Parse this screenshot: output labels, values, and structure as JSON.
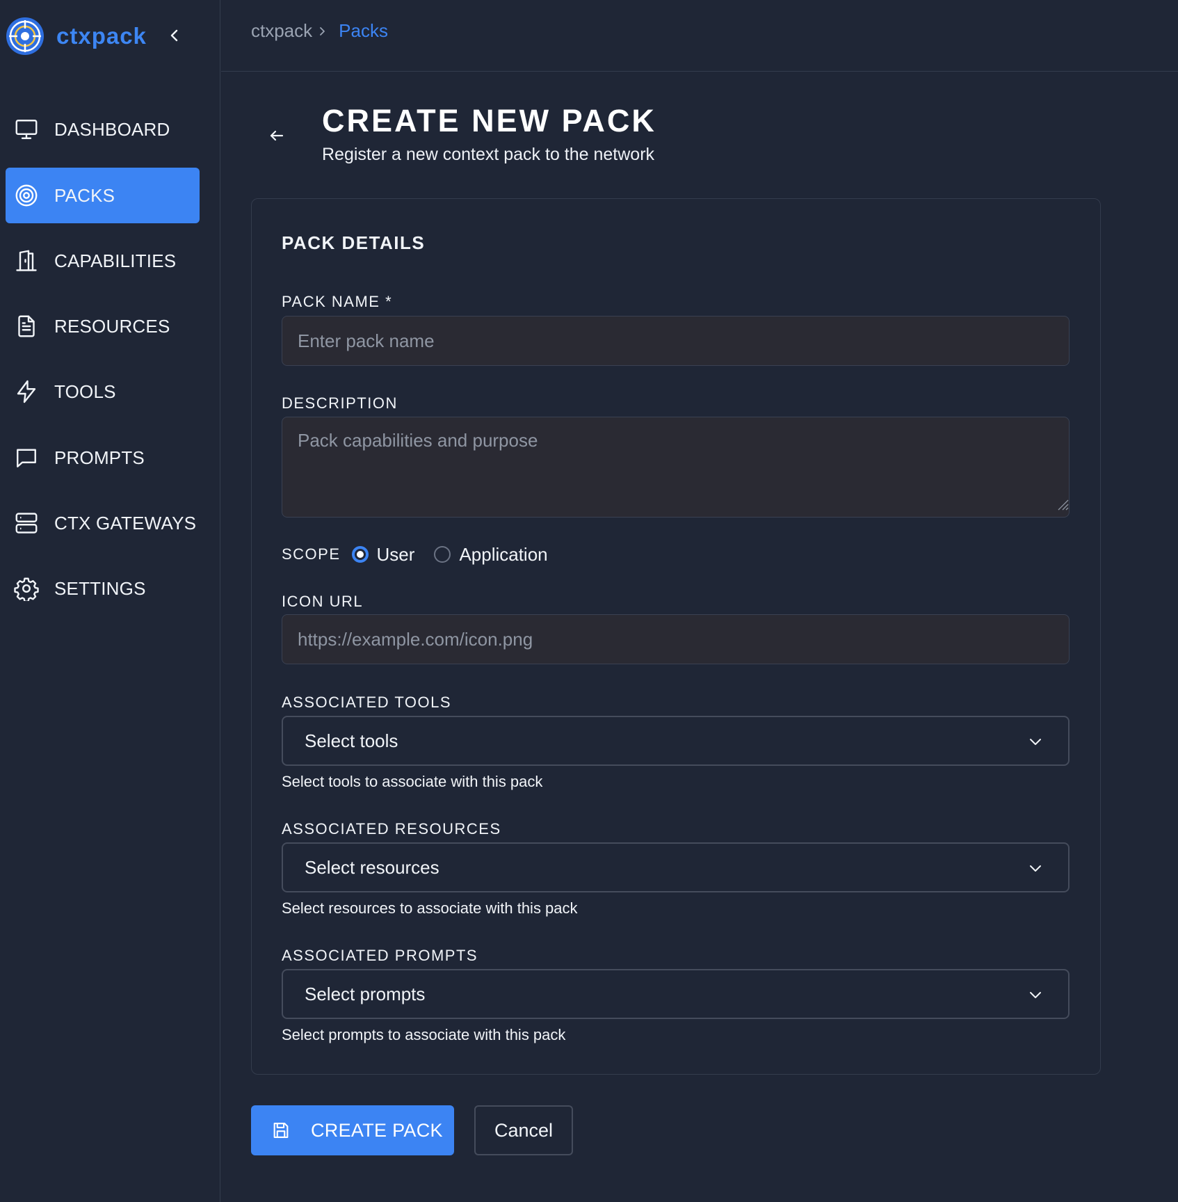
{
  "app": {
    "name": "ctxpack"
  },
  "sidebar": {
    "items": [
      {
        "label": "DASHBOARD",
        "icon": "monitor-icon",
        "active": false
      },
      {
        "label": "PACKS",
        "icon": "target-icon",
        "active": true
      },
      {
        "label": "CAPABILITIES",
        "icon": "door-icon",
        "active": false
      },
      {
        "label": "RESOURCES",
        "icon": "document-icon",
        "active": false
      },
      {
        "label": "TOOLS",
        "icon": "lightning-icon",
        "active": false
      },
      {
        "label": "PROMPTS",
        "icon": "chat-bubble-icon",
        "active": false
      },
      {
        "label": "CTX GATEWAYS",
        "icon": "server-icon",
        "active": false
      },
      {
        "label": "SETTINGS",
        "icon": "gear-icon",
        "active": false
      }
    ]
  },
  "breadcrumb": {
    "root": "ctxpack",
    "current": "Packs"
  },
  "page": {
    "title": "CREATE NEW PACK",
    "subtitle": "Register a new context pack to the network"
  },
  "form": {
    "section_title": "PACK DETAILS",
    "pack_name": {
      "label": "PACK NAME *",
      "placeholder": "Enter pack name",
      "value": ""
    },
    "description": {
      "label": "DESCRIPTION",
      "placeholder": "Pack capabilities and purpose",
      "value": ""
    },
    "scope": {
      "label": "SCOPE",
      "options": [
        "User",
        "Application"
      ],
      "selected": "User"
    },
    "icon_url": {
      "label": "ICON URL",
      "placeholder": "https://example.com/icon.png",
      "value": ""
    },
    "tools": {
      "label": "ASSOCIATED TOOLS",
      "value": "Select tools",
      "helper": "Select tools to associate with this pack"
    },
    "resources": {
      "label": "ASSOCIATED RESOURCES",
      "value": "Select resources",
      "helper": "Select resources to associate with this pack"
    },
    "prompts": {
      "label": "ASSOCIATED PROMPTS",
      "value": "Select prompts",
      "helper": "Select prompts to associate with this pack"
    }
  },
  "actions": {
    "create_label": "CREATE PACK",
    "cancel_label": "Cancel"
  },
  "colors": {
    "accent": "#3c84f3",
    "background": "#1f2636",
    "input_bg": "#2a2a33"
  }
}
